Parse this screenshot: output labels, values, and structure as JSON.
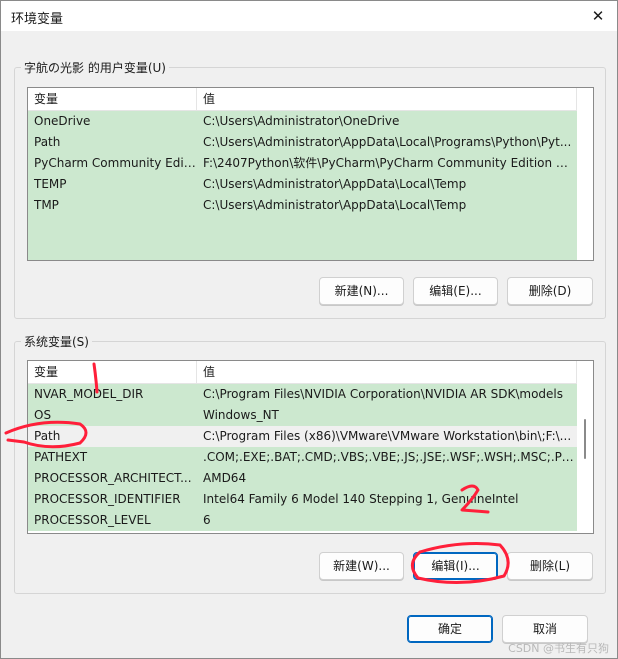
{
  "window": {
    "title": "环境变量",
    "close_glyph": "✕"
  },
  "user_section": {
    "label": "字航の光影 的用户变量(U)",
    "headers": {
      "variable": "变量",
      "value": "值"
    },
    "rows": [
      {
        "name": "OneDrive",
        "value": "C:\\Users\\Administrator\\OneDrive"
      },
      {
        "name": "Path",
        "value": "C:\\Users\\Administrator\\AppData\\Local\\Programs\\Python\\Pyt..."
      },
      {
        "name": "PyCharm Community Editi...",
        "value": "F:\\2407Python\\软件\\PyCharm\\PyCharm Community Edition 20..."
      },
      {
        "name": "TEMP",
        "value": "C:\\Users\\Administrator\\AppData\\Local\\Temp"
      },
      {
        "name": "TMP",
        "value": "C:\\Users\\Administrator\\AppData\\Local\\Temp"
      }
    ],
    "buttons": {
      "new": "新建(N)...",
      "edit": "编辑(E)...",
      "delete": "删除(D)"
    }
  },
  "system_section": {
    "label": "系统变量(S)",
    "headers": {
      "variable": "变量",
      "value": "值"
    },
    "rows": [
      {
        "name": "NVAR_MODEL_DIR",
        "value": "C:\\Program Files\\NVIDIA Corporation\\NVIDIA AR SDK\\models"
      },
      {
        "name": "OS",
        "value": "Windows_NT"
      },
      {
        "name": "Path",
        "value": "C:\\Program Files (x86)\\VMware\\VMware Workstation\\bin\\;F:\\..."
      },
      {
        "name": "PATHEXT",
        "value": ".COM;.EXE;.BAT;.CMD;.VBS;.VBE;.JS;.JSE;.WSF;.WSH;.MSC;.PY;.P..."
      },
      {
        "name": "PROCESSOR_ARCHITECT...",
        "value": "AMD64"
      },
      {
        "name": "PROCESSOR_IDENTIFIER",
        "value": "Intel64 Family 6 Model 140 Stepping 1, GenuineIntel"
      },
      {
        "name": "PROCESSOR_LEVEL",
        "value": "6"
      }
    ],
    "selected_row": "Path",
    "buttons": {
      "new": "新建(W)...",
      "edit": "编辑(I)...",
      "delete": "删除(L)"
    }
  },
  "footer": {
    "ok": "确定",
    "cancel": "取消"
  },
  "watermark": "CSDN @书生有只狗",
  "annotation_color": "#ff1f3a"
}
